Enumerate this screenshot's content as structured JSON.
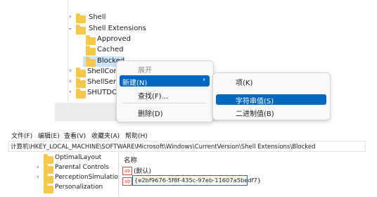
{
  "top_tree": {
    "items": [
      {
        "label": "Shell"
      },
      {
        "label": "Shell Extensions"
      },
      {
        "label": "Approved"
      },
      {
        "label": "Cached"
      },
      {
        "label": "Blocked"
      },
      {
        "label": "ShellCom"
      },
      {
        "label": "ShellServ"
      },
      {
        "label": "SHUTDOV"
      }
    ]
  },
  "context_menu": {
    "expand": "展开",
    "new": "新建(N)",
    "new_arrow": "›",
    "find": "查找(F)...",
    "delete": "删除(D)"
  },
  "submenu": {
    "key": "项(K)",
    "string_value": "字符串值(S)",
    "binary_value": "二进制值(B)"
  },
  "menubar": {
    "file": "文件(F)",
    "edit": "编辑(E)",
    "view": "查看(V)",
    "favorites": "收藏夹(A)",
    "help": "帮助(H)"
  },
  "address": "计算机\\HKEY_LOCAL_MACHINE\\SOFTWARE\\Microsoft\\Windows\\CurrentVersion\\Shell Extensions\\Blocked",
  "bottom_tree": {
    "items": [
      {
        "label": "OptimalLayout"
      },
      {
        "label": "Parental Controls"
      },
      {
        "label": "PerceptionSimulatio"
      },
      {
        "label": "Personalization"
      }
    ]
  },
  "values_pane": {
    "column_name": "名称",
    "rows": [
      {
        "icon": "ab",
        "name": "(默认)"
      },
      {
        "icon": "ab",
        "name": "{e2bf9676-5f8f-435c-97eb-11607a5bedf7}"
      }
    ]
  },
  "colors": {
    "highlight": "#0067c0",
    "selected_item_bg": "#cce4f7",
    "folder": "#f5c74a",
    "string_icon": "#d24a3c"
  }
}
